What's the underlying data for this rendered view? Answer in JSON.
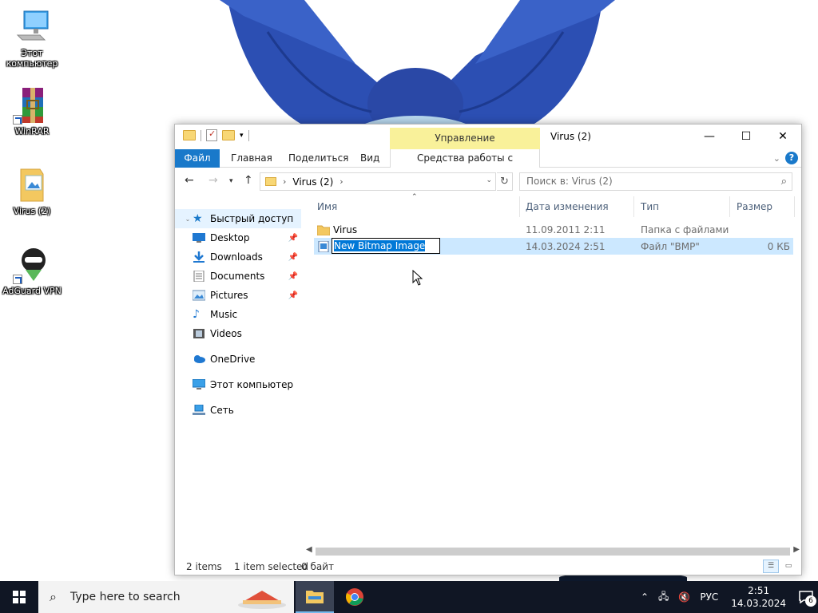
{
  "desktop": {
    "icons": [
      {
        "name": "this-pc",
        "label": "Этот компьютер"
      },
      {
        "name": "winrar",
        "label": "WinRAR"
      },
      {
        "name": "virus-folder",
        "label": "Virus (2)"
      },
      {
        "name": "adguard-vpn",
        "label": "AdGuard VPN"
      }
    ]
  },
  "window": {
    "title": "Virus (2)",
    "context_tab_header": "Управление",
    "controls": {
      "minimize": "—",
      "maximize": "☐",
      "close": "✕"
    },
    "ribbon_tabs": {
      "file": "Файл",
      "home": "Главная",
      "share": "Поделиться",
      "view": "Вид",
      "picture_tools": "Средства работы с рисунками"
    },
    "address": {
      "path": "Virus (2)"
    },
    "search": {
      "placeholder": "Поиск в: Virus (2)"
    },
    "sidebar": {
      "quick_access": "Быстрый доступ",
      "items": [
        {
          "label": "Desktop",
          "pinned": true
        },
        {
          "label": "Downloads",
          "pinned": true
        },
        {
          "label": "Documents",
          "pinned": true
        },
        {
          "label": "Pictures",
          "pinned": true
        },
        {
          "label": "Music",
          "pinned": false
        },
        {
          "label": "Videos",
          "pinned": false
        }
      ],
      "onedrive": "OneDrive",
      "this_pc": "Этот компьютер",
      "network": "Сеть"
    },
    "columns": {
      "name": "Имя",
      "date": "Дата изменения",
      "type": "Тип",
      "size": "Размер"
    },
    "files": [
      {
        "name": "Virus",
        "date": "11.09.2011 2:11",
        "type": "Папка с файлами",
        "size": "",
        "icon": "folder-icon"
      },
      {
        "name": "New Bitmap Image",
        "date": "14.03.2024 2:51",
        "type": "Файл \"BMP\"",
        "size": "0 КБ",
        "icon": "bitmap-file-icon",
        "selected": true,
        "renaming": true
      }
    ],
    "status": {
      "items": "2 items",
      "selected": "1 item selected",
      "size": "0 байт"
    }
  },
  "taskbar": {
    "search_placeholder": "Type here to search",
    "language": "РУС",
    "time": "2:51",
    "date": "14.03.2024",
    "notification_count": "6"
  },
  "colors": {
    "accent": "#1979ca",
    "selection": "#cce8ff",
    "context_tab": "#f9f19a",
    "taskbar": "#101624",
    "bow": "#2c4fb3"
  }
}
